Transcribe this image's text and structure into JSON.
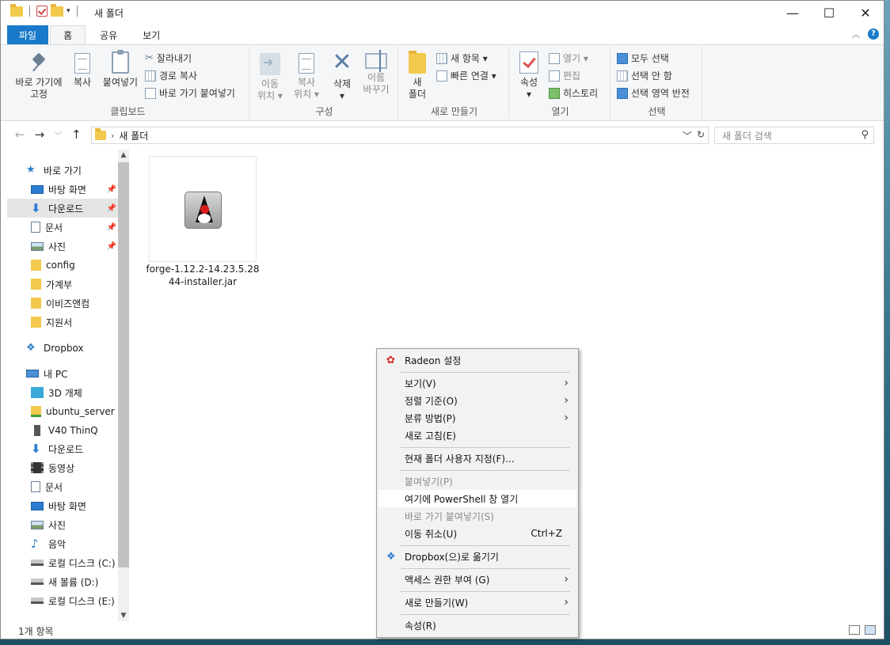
{
  "window": {
    "title": "새 폴더",
    "controls": [
      "minimize",
      "maximize",
      "close"
    ]
  },
  "ribbon_tabs": [
    "파일",
    "홈",
    "공유",
    "보기"
  ],
  "ribbon": {
    "clipboard": {
      "label": "클립보드",
      "pin": [
        "바로 가기에",
        "고정"
      ],
      "copy": "복사",
      "paste": "붙여넣기",
      "cut": "잘라내기",
      "copy_path": "경로 복사",
      "paste_shortcut": "바로 가기 붙여넣기"
    },
    "organize": {
      "label": "구성",
      "move_to": [
        "이동",
        "위치 ▾"
      ],
      "copy_to": [
        "복사",
        "위치 ▾"
      ],
      "delete": [
        "삭제",
        "▾"
      ],
      "rename": [
        "이름",
        "바꾸기"
      ]
    },
    "new": {
      "label": "새로 만들기",
      "new_folder": [
        "새",
        "폴더"
      ],
      "new_item": "새 항목 ▾",
      "easy_access": "빠른 연결 ▾"
    },
    "open": {
      "label": "열기",
      "properties": [
        "속성",
        "▾"
      ],
      "open": "열기 ▾",
      "edit": "편집",
      "history": "히스토리"
    },
    "select": {
      "label": "선택",
      "select_all": "모두 선택",
      "select_none": "선택 안 함",
      "invert": "선택 영역 반전"
    }
  },
  "address": {
    "path": "새 폴더",
    "search_placeholder": "새 폴더 검색"
  },
  "sidebar": {
    "quick_access": "바로 가기",
    "items": [
      {
        "label": "바탕 화면",
        "icon": "desktop-icon",
        "pinned": true
      },
      {
        "label": "다운로드",
        "icon": "download-icon",
        "pinned": true,
        "selected": true
      },
      {
        "label": "문서",
        "icon": "document-icon",
        "pinned": true
      },
      {
        "label": "사진",
        "icon": "picture-icon",
        "pinned": true
      },
      {
        "label": "config",
        "icon": "folder-icon"
      },
      {
        "label": "가계부",
        "icon": "folder-icon"
      },
      {
        "label": "이비즈앤컴",
        "icon": "folder-icon"
      },
      {
        "label": "지원서",
        "icon": "folder-icon"
      }
    ],
    "dropbox": "Dropbox",
    "this_pc": "내 PC",
    "pc_items": [
      {
        "label": "3D 개체",
        "icon": "3d-objects-icon"
      },
      {
        "label": "ubuntu_server",
        "icon": "network-folder-icon"
      },
      {
        "label": "V40 ThinQ",
        "icon": "phone-icon"
      },
      {
        "label": "다운로드",
        "icon": "download-icon"
      },
      {
        "label": "동영상",
        "icon": "video-icon"
      },
      {
        "label": "문서",
        "icon": "document-icon"
      },
      {
        "label": "바탕 화면",
        "icon": "desktop-icon"
      },
      {
        "label": "사진",
        "icon": "picture-icon"
      },
      {
        "label": "음악",
        "icon": "music-icon"
      },
      {
        "label": "로컬 디스크 (C:)",
        "icon": "drive-icon"
      },
      {
        "label": "새 볼륨 (D:)",
        "icon": "drive-icon"
      },
      {
        "label": "로컬 디스크 (E:)",
        "icon": "drive-icon"
      }
    ]
  },
  "files": [
    {
      "name": "forge-1.12.2-14.23.5.2844-installer.jar",
      "name_line1": "forge-1.12.2-14.23.5.28",
      "name_line2": "44-installer.jar",
      "icon": "java-jar-icon"
    }
  ],
  "status": {
    "item_count": "1개 항목"
  },
  "context_menu": {
    "items": [
      {
        "label": "Radeon 설정",
        "icon": "radeon-icon"
      },
      {
        "label": "보기(V)",
        "submenu": true
      },
      {
        "label": "정렬 기준(O)",
        "submenu": true
      },
      {
        "label": "분류 방법(P)",
        "submenu": true
      },
      {
        "label": "새로 고침(E)"
      },
      {
        "label": "현재 폴더 사용자 지정(F)..."
      },
      {
        "label": "붙여넣기(P)",
        "disabled": true
      },
      {
        "label": "여기에 PowerShell 창 열기",
        "highlighted": true
      },
      {
        "label": "바로 가기 붙여넣기(S)",
        "disabled": true
      },
      {
        "label": "이동 취소(U)",
        "shortcut": "Ctrl+Z"
      },
      {
        "label": "Dropbox(으)로 옮기기",
        "icon": "dropbox-icon"
      },
      {
        "label": "액세스 권한 부여 (G)",
        "submenu": true
      },
      {
        "label": "새로 만들기(W)",
        "submenu": true
      },
      {
        "label": "속성(R)"
      }
    ]
  }
}
